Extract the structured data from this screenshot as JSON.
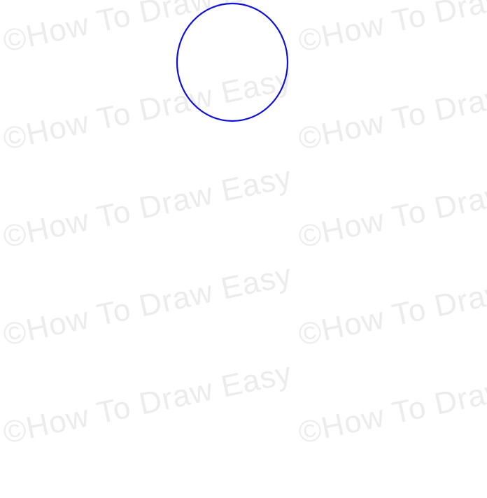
{
  "watermark": {
    "text": "©How To Draw Easy",
    "color": "#ececec"
  },
  "drawing": {
    "shape": "circle",
    "stroke_color": "#1010d8",
    "fill": "none"
  }
}
